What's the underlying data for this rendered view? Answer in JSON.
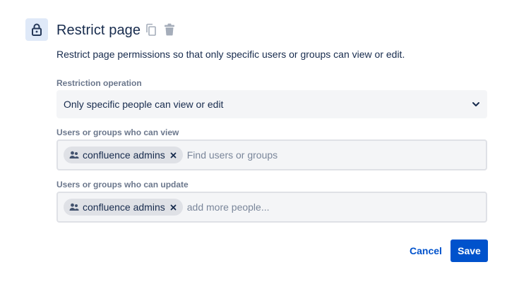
{
  "dialog": {
    "title": "Restrict page",
    "description": "Restrict page permissions so that only specific users or groups can view or edit."
  },
  "icons": {
    "header": "lock-icon",
    "copy": "copy-icon",
    "delete": "trash-icon",
    "select_chevron": "chevron-down-icon",
    "group": "group-icon",
    "remove": "close-icon"
  },
  "restriction": {
    "label": "Restriction operation",
    "selected": "Only specific people can view or edit"
  },
  "view": {
    "label": "Users or groups who can view",
    "chips": [
      {
        "label": "confluence admins"
      }
    ],
    "placeholder": "Find users or groups"
  },
  "update": {
    "label": "Users or groups who can update",
    "chips": [
      {
        "label": "confluence admins"
      }
    ],
    "placeholder": "add more people..."
  },
  "footer": {
    "cancel_label": "Cancel",
    "save_label": "Save"
  },
  "colors": {
    "accent": "#0052cc",
    "icon_bg": "#dfe9f8",
    "field_bg": "#f4f5f7",
    "chip_bg": "#dfe1e6",
    "muted_text": "#6b778c"
  }
}
